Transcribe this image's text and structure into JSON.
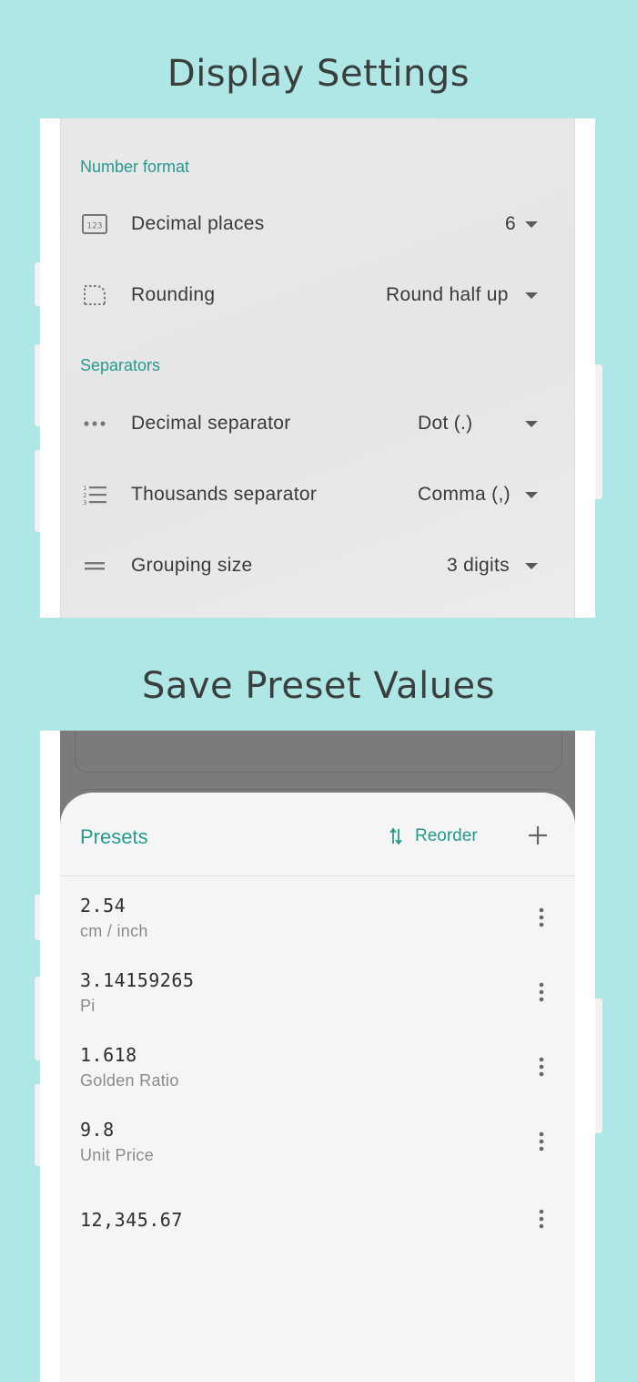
{
  "headlines": {
    "display_settings": "Display Settings",
    "save_preset_values": "Save Preset Values"
  },
  "display_settings": {
    "sections": [
      {
        "title": "Number format",
        "rows": [
          {
            "icon": "numeric-123-icon",
            "label": "Decimal places",
            "value": "6"
          },
          {
            "icon": "rounding-icon",
            "label": "Rounding",
            "value": "Round half up"
          }
        ]
      },
      {
        "title": "Separators",
        "rows": [
          {
            "icon": "dots-horizontal-icon",
            "label": "Decimal separator",
            "value": "Dot (.)"
          },
          {
            "icon": "format-list-numbered-icon",
            "label": "Thousands separator",
            "value": "Comma (,)"
          },
          {
            "icon": "equal-icon",
            "label": "Grouping size",
            "value": "3 digits"
          }
        ]
      }
    ]
  },
  "presets_sheet": {
    "title": "Presets",
    "reorder_label": "Reorder",
    "items": [
      {
        "value": "2.54",
        "name": "cm / inch"
      },
      {
        "value": "3.14159265",
        "name": "Pi"
      },
      {
        "value": "1.618",
        "name": "Golden Ratio"
      },
      {
        "value": "9.8",
        "name": "Unit Price"
      },
      {
        "value": "12,345.67",
        "name": ""
      }
    ]
  },
  "colors": {
    "background": "#aee7e6",
    "accent": "#259a8d"
  }
}
